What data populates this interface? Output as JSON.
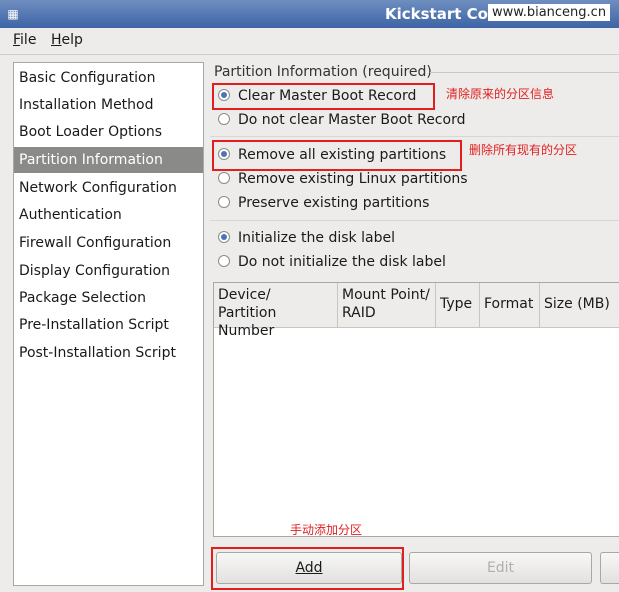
{
  "window": {
    "title": "Kickstart Co",
    "watermark": "www.bianceng.cn"
  },
  "menu": [
    {
      "label": "File",
      "mnemonic": "F",
      "rest": "ile"
    },
    {
      "label": "Help",
      "mnemonic": "H",
      "rest": "elp"
    }
  ],
  "sidebar": {
    "items": [
      "Basic Configuration",
      "Installation Method",
      "Boot Loader Options",
      "Partition Information",
      "Network Configuration",
      "Authentication",
      "Firewall Configuration",
      "Display Configuration",
      "Package Selection",
      "Pre-Installation Script",
      "Post-Installation Script"
    ],
    "selected_index": 3
  },
  "panel": {
    "group_title": "Partition Information (required)",
    "mbr": {
      "options": [
        "Clear Master Boot Record",
        "Do not clear Master Boot Record"
      ],
      "selected_index": 0
    },
    "partitions": {
      "options": [
        "Remove all existing partitions",
        "Remove existing Linux partitions",
        "Preserve existing partitions"
      ],
      "selected_index": 0
    },
    "disklabel": {
      "options": [
        "Initialize the disk label",
        "Do not initialize the disk label"
      ],
      "selected_index": 0
    },
    "table_headers": [
      [
        "Device/",
        "Partition Number"
      ],
      [
        "Mount Point/",
        "RAID"
      ],
      [
        "Type"
      ],
      [
        "Format"
      ],
      [
        "Size (MB)"
      ]
    ],
    "buttons": {
      "add": "Add",
      "edit": "Edit"
    }
  },
  "annotations": {
    "clear_mbr": "清除原来的分区信息",
    "remove_all": "删除所有现有的分区",
    "add_manual": "手动添加分区"
  },
  "colors": {
    "annotation": "#e02020",
    "selected_row": "#8a8a88",
    "titlebar": "#3d64a5"
  }
}
